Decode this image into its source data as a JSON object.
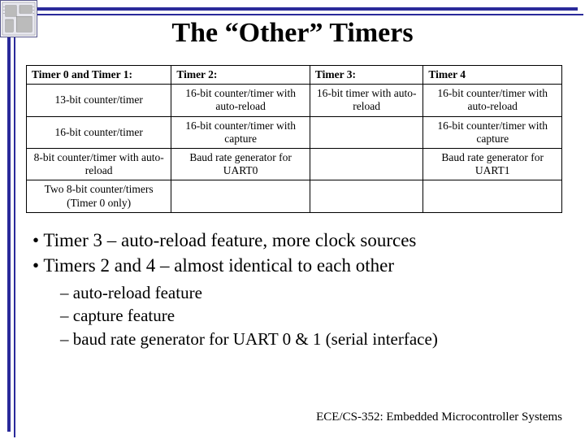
{
  "title": "The “Other” Timers",
  "footer": "ECE/CS-352: Embedded Microcontroller Systems",
  "table": {
    "headers": [
      "Timer 0 and Timer 1:",
      "Timer 2:",
      "Timer 3:",
      "Timer 4"
    ],
    "rows": [
      [
        "13-bit counter/timer",
        "16-bit counter/timer with auto-reload",
        "16-bit timer with auto-reload",
        "16-bit counter/timer with auto-reload"
      ],
      [
        "16-bit counter/timer",
        "16-bit counter/timer with capture",
        "",
        "16-bit counter/timer with capture"
      ],
      [
        "8-bit counter/timer with auto-reload",
        "Baud rate generator for UART0",
        "",
        "Baud rate generator for UART1"
      ],
      [
        "Two 8-bit counter/timers (Timer 0 only)",
        "",
        "",
        ""
      ]
    ]
  },
  "bullets": {
    "level1": [
      "Timer 3 – auto-reload feature, more clock sources",
      "Timers 2 and 4 – almost identical to each other"
    ],
    "level2": [
      "auto-reload feature",
      "capture feature",
      "baud rate generator for UART 0 & 1 (serial interface)"
    ]
  }
}
